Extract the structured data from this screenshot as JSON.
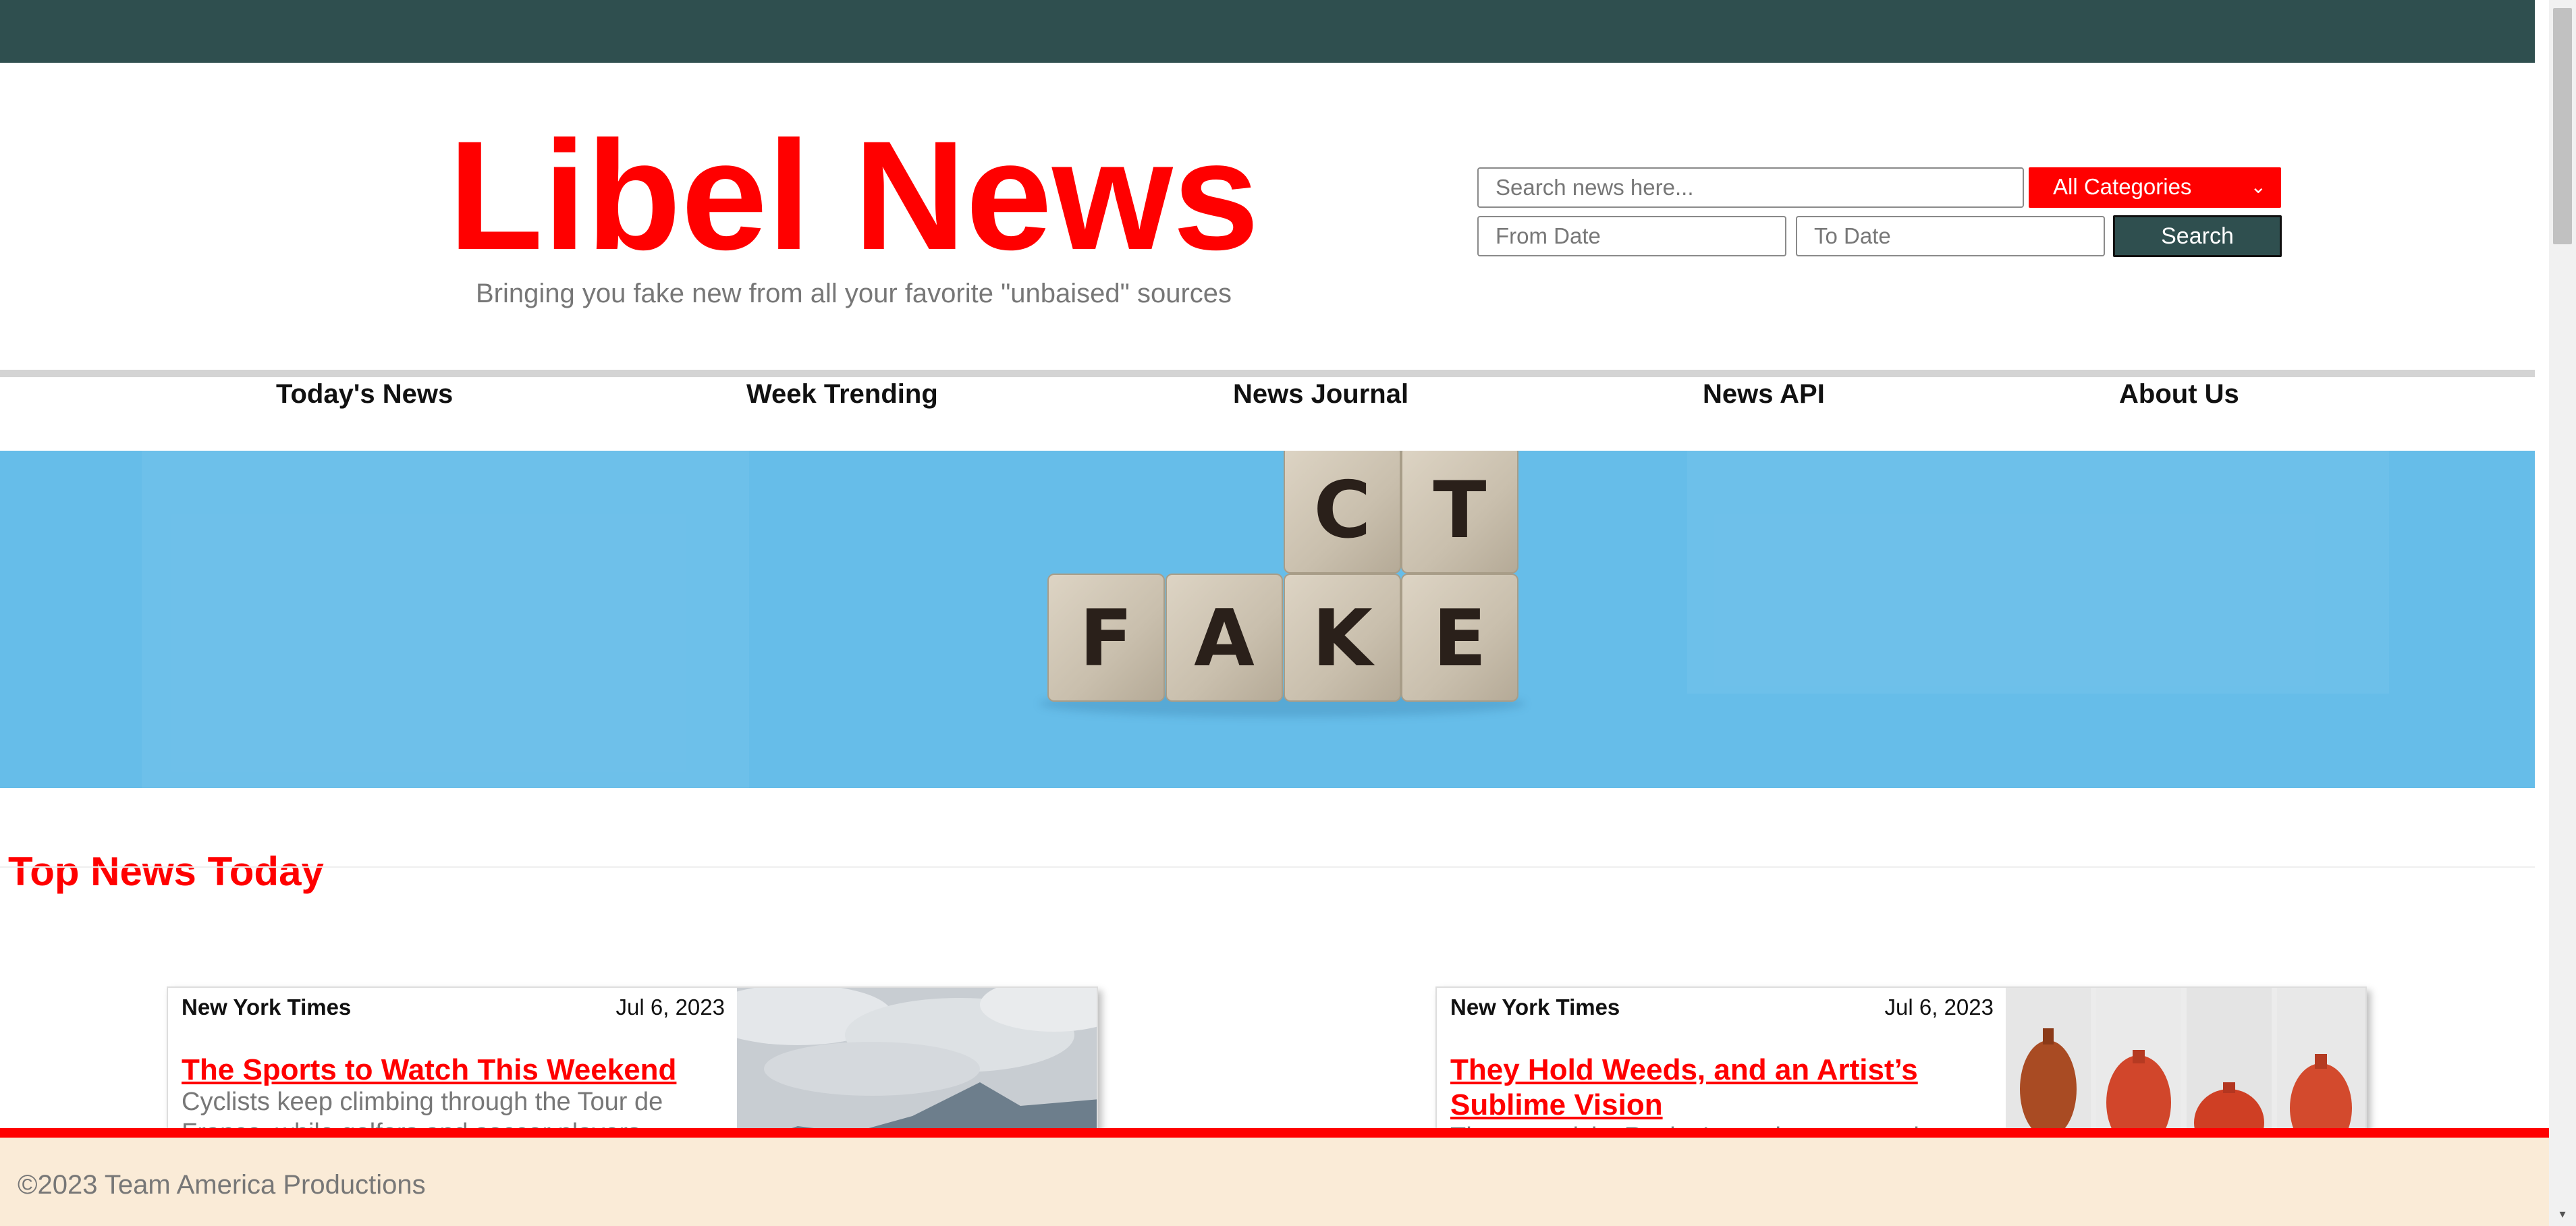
{
  "site": {
    "name": "Libel News",
    "tagline": "Bringing you fake new from all your favorite \"unbaised\" sources"
  },
  "search": {
    "placeholder": "Search news here...",
    "category_selected": "All Categories",
    "from_placeholder": "From Date",
    "to_placeholder": "To Date",
    "button_label": "Search"
  },
  "nav": [
    {
      "label": "Today's News"
    },
    {
      "label": "Week Trending"
    },
    {
      "label": "News Journal"
    },
    {
      "label": "News API"
    },
    {
      "label": "About Us"
    }
  ],
  "hero": {
    "top_letters": [
      "C",
      "T"
    ],
    "bottom_letters": [
      "F",
      "A",
      "K",
      "E"
    ]
  },
  "section": {
    "title": "Top News Today"
  },
  "articles": [
    {
      "source": "New York Times",
      "date": "Jul 6, 2023",
      "title": "The Sports to Watch This Weekend",
      "excerpt": "Cyclists keep climbing through the Tour de France, while golfers and soccer players"
    },
    {
      "source": "New York Times",
      "date": "Jul 6, 2023",
      "title": "They Hold Weeds, and an Artist’s Sublime Vision",
      "excerpt": "The ceramicist Rocky Lewycky creates pieces"
    }
  ],
  "footer": {
    "text": "©2023 Team America Productions"
  },
  "colors": {
    "brand": "#ff0000",
    "topbar": "#2f4f4f",
    "footer_bg": "#faebd7",
    "hero_bg": "#66bde9"
  },
  "icons": {
    "select_arrow": "chevron-down-icon",
    "scroll_up": "scroll-up-arrow-icon",
    "scroll_down": "scroll-down-arrow-icon"
  }
}
